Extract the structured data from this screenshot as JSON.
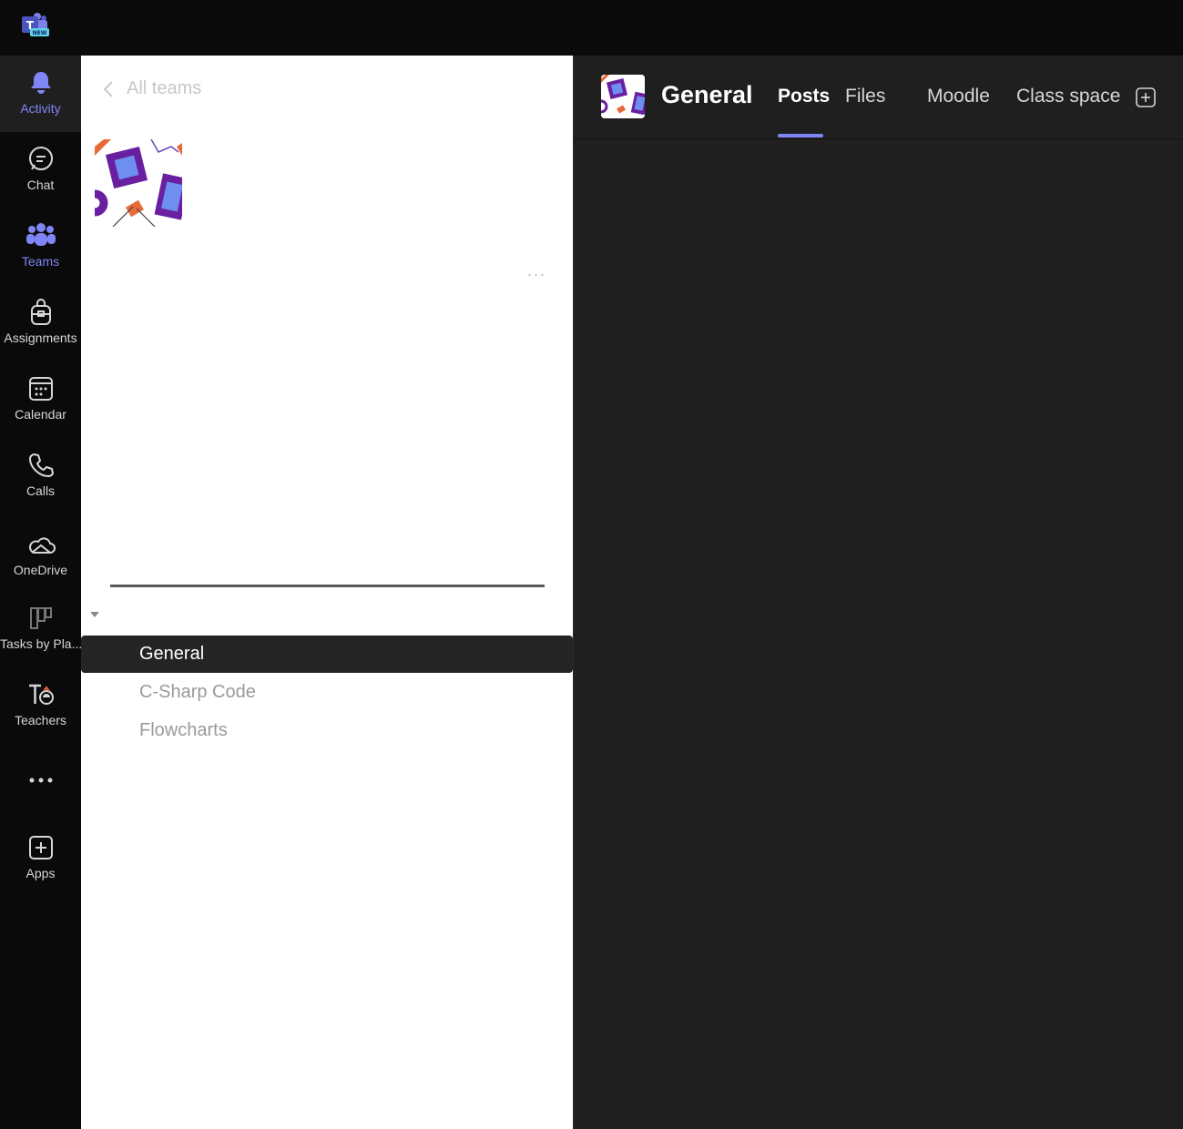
{
  "titlebar": {
    "logo_text": "T",
    "logo_badge": "NEW"
  },
  "rail": {
    "items": [
      {
        "label": "Activity",
        "icon": "bell-icon"
      },
      {
        "label": "Chat",
        "icon": "chat-icon"
      },
      {
        "label": "Teams",
        "icon": "teams-icon"
      },
      {
        "label": "Assignments",
        "icon": "backpack-icon"
      },
      {
        "label": "Calendar",
        "icon": "calendar-icon"
      },
      {
        "label": "Calls",
        "icon": "phone-icon"
      },
      {
        "label": "OneDrive",
        "icon": "cloud-icon"
      },
      {
        "label": "Tasks by Pla...",
        "icon": "planner-icon"
      },
      {
        "label": "Teachers",
        "icon": "teachers-icon"
      },
      {
        "label": "",
        "icon": "more-icon"
      },
      {
        "label": "Apps",
        "icon": "add-apps-icon"
      }
    ]
  },
  "team_panel": {
    "back_label": "All teams",
    "more_label": "...",
    "channels": [
      {
        "name": "General",
        "selected": true
      },
      {
        "name": "C-Sharp Code",
        "selected": false
      },
      {
        "name": "Flowcharts",
        "selected": false
      }
    ]
  },
  "main": {
    "title": "General",
    "tabs": [
      {
        "label": "Posts",
        "active": true
      },
      {
        "label": "Files",
        "active": false
      },
      {
        "label": "Moodle",
        "active": false
      },
      {
        "label": "Class space",
        "active": false
      }
    ]
  },
  "colors": {
    "accent": "#7f85f5",
    "rail_bg": "#0a0a0a",
    "main_bg": "#1f1f1f",
    "panel_bg": "#ffffff",
    "selected_channel_bg": "#242424"
  }
}
